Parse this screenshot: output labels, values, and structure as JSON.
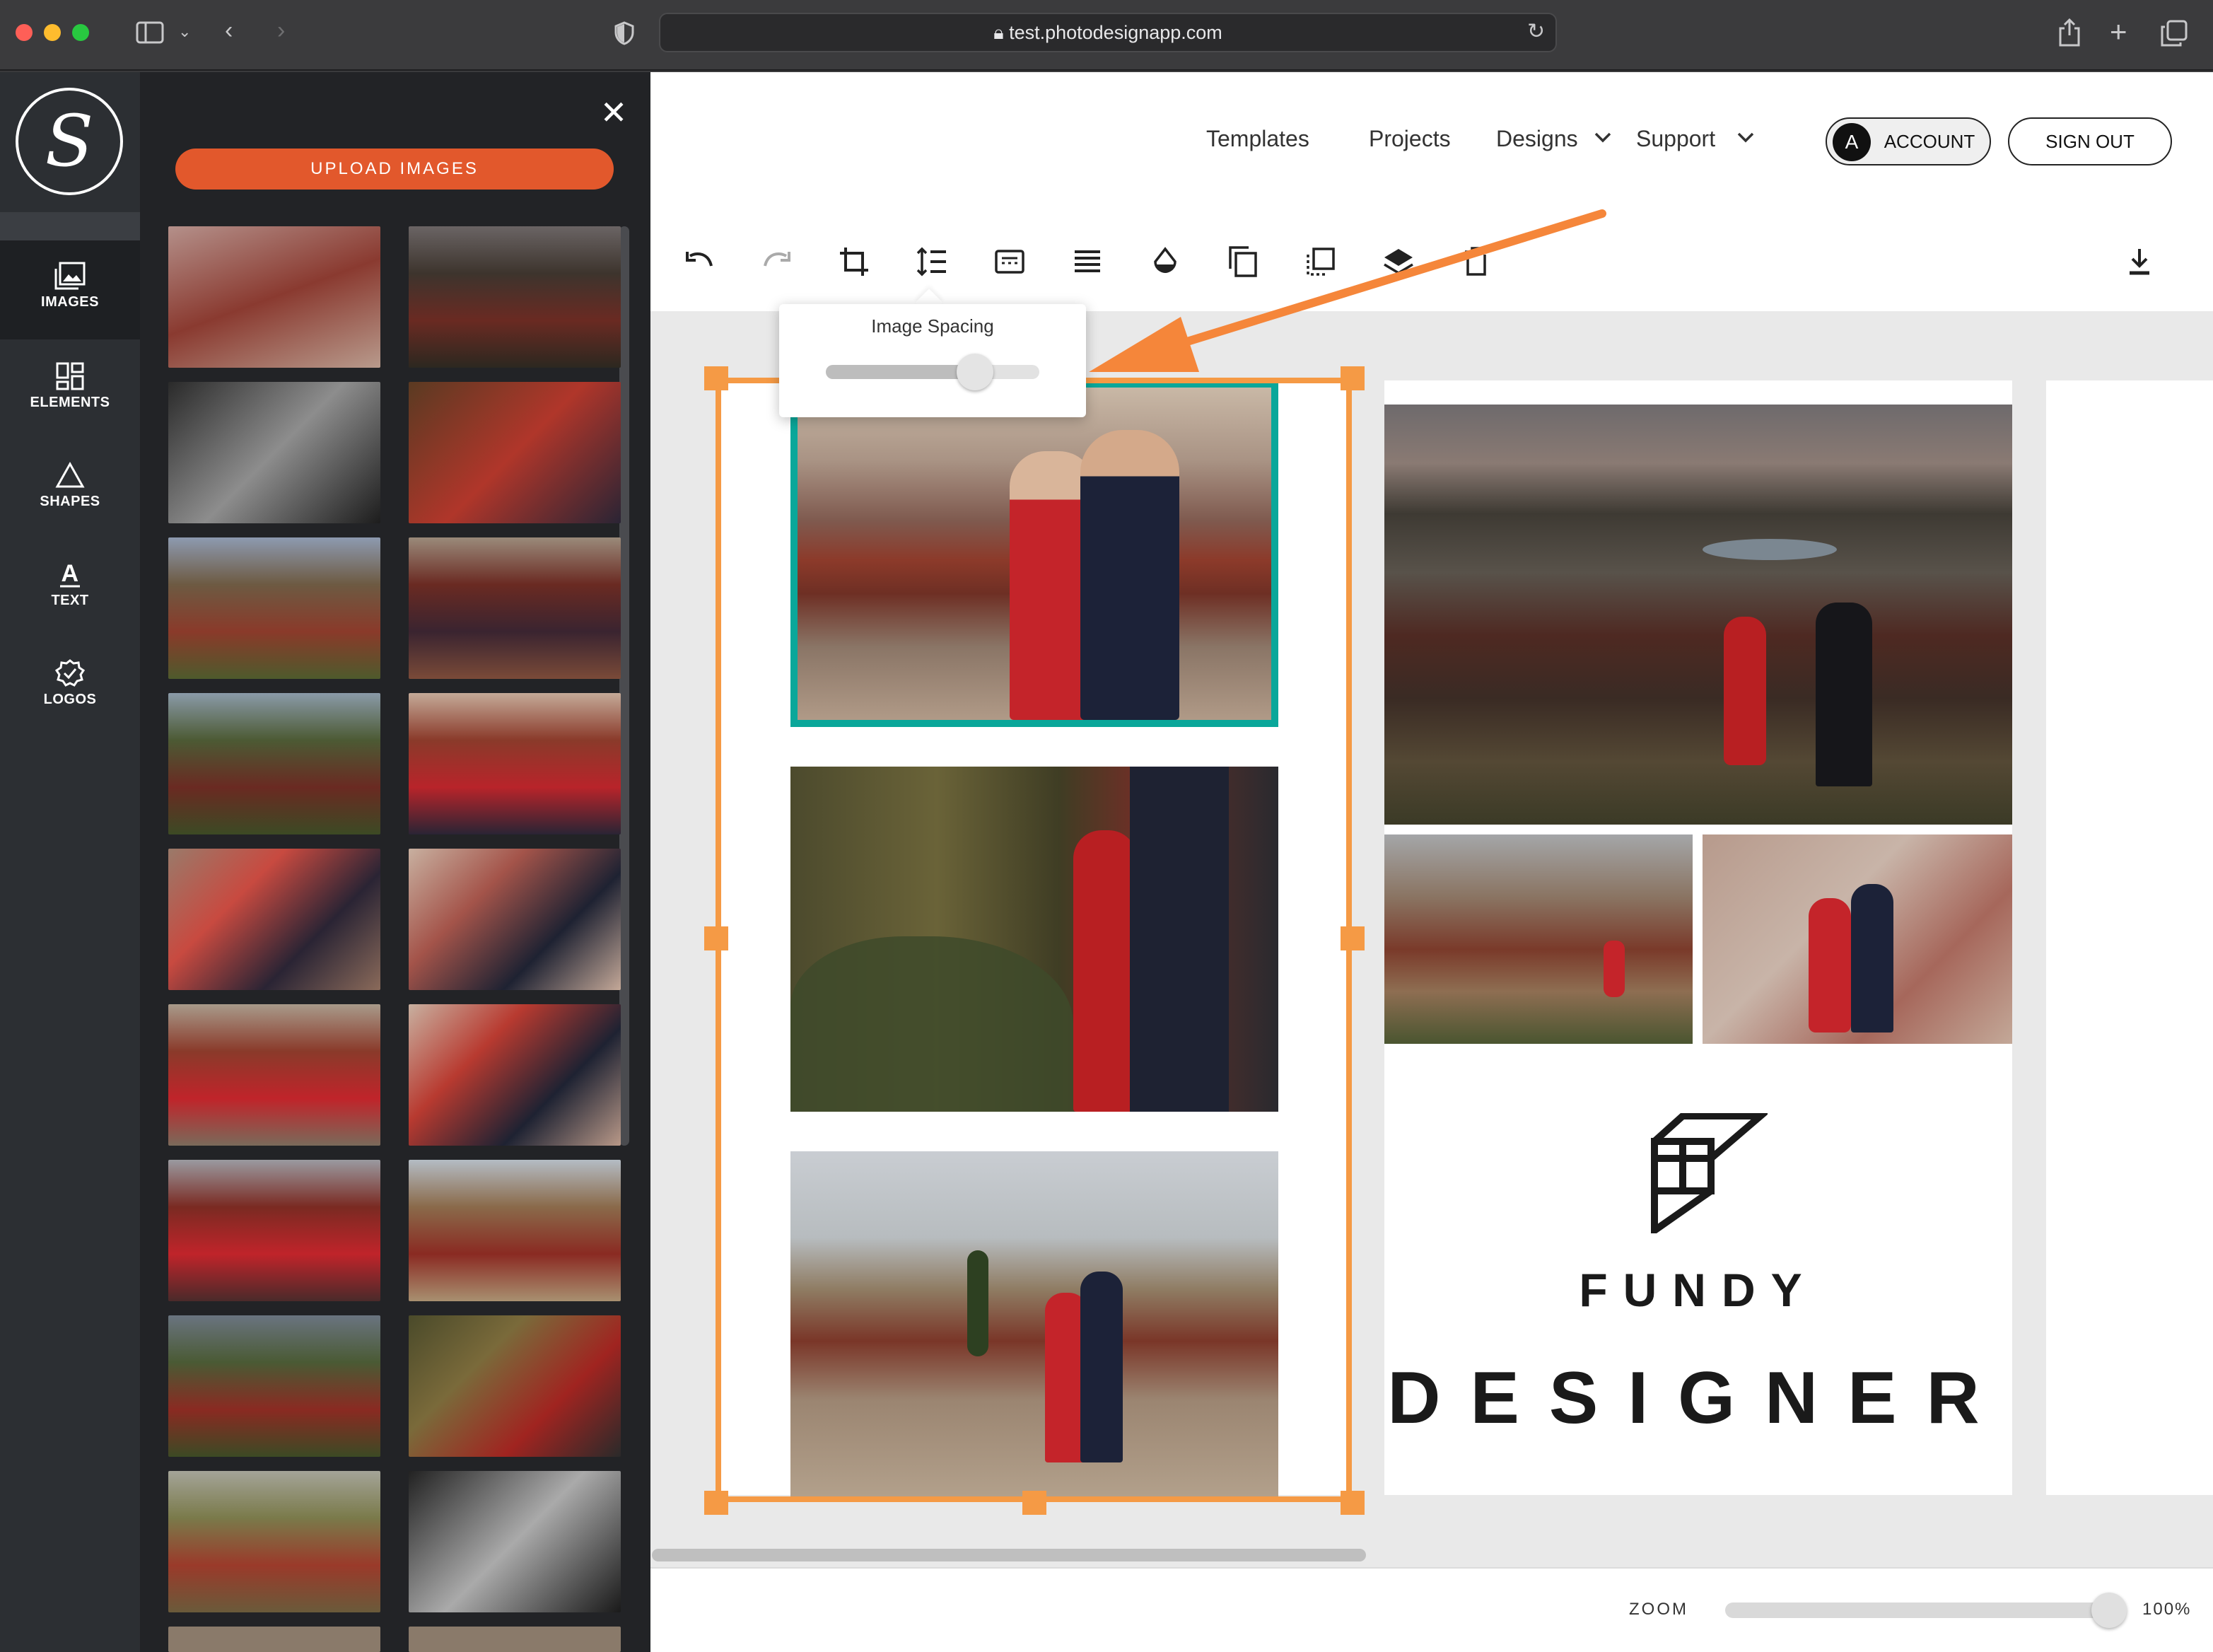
{
  "browser": {
    "url": "test.photodesignapp.com"
  },
  "sidebar": {
    "logo_letter": "S",
    "items": [
      {
        "label": "IMAGES",
        "icon": "images-icon"
      },
      {
        "label": "ELEMENTS",
        "icon": "elements-icon"
      },
      {
        "label": "SHAPES",
        "icon": "shapes-icon"
      },
      {
        "label": "TEXT",
        "icon": "text-icon"
      },
      {
        "label": "LOGOS",
        "icon": "logos-icon"
      }
    ]
  },
  "panel": {
    "upload_label": "UPLOAD IMAGES",
    "close_glyph": "✕",
    "thumbnail_count": 18
  },
  "nav": {
    "templates": "Templates",
    "projects": "Projects",
    "designs": "Designs",
    "support": "Support",
    "account_initial": "A",
    "account_label": "ACCOUNT",
    "signout_label": "SIGN OUT"
  },
  "toolbar": {
    "tools": [
      "undo-icon",
      "redo-icon",
      "crop-icon",
      "image-spacing-icon",
      "caption-icon",
      "align-icon",
      "fill-icon",
      "duplicate-icon",
      "arrange-icon",
      "layers-icon",
      "delete-icon",
      "download-icon"
    ]
  },
  "tooltip": {
    "label": "Image Spacing",
    "value": 0.7
  },
  "brand": {
    "line1": "FUNDY",
    "line2": "DESIGNER"
  },
  "zoom": {
    "label": "ZOOM",
    "value": "100%"
  },
  "colors": {
    "accent_orange": "#e2582c",
    "selection_orange": "#f59a45",
    "selected_teal": "#0aa79a",
    "rail": "#2c2f33",
    "panel": "#222326"
  }
}
